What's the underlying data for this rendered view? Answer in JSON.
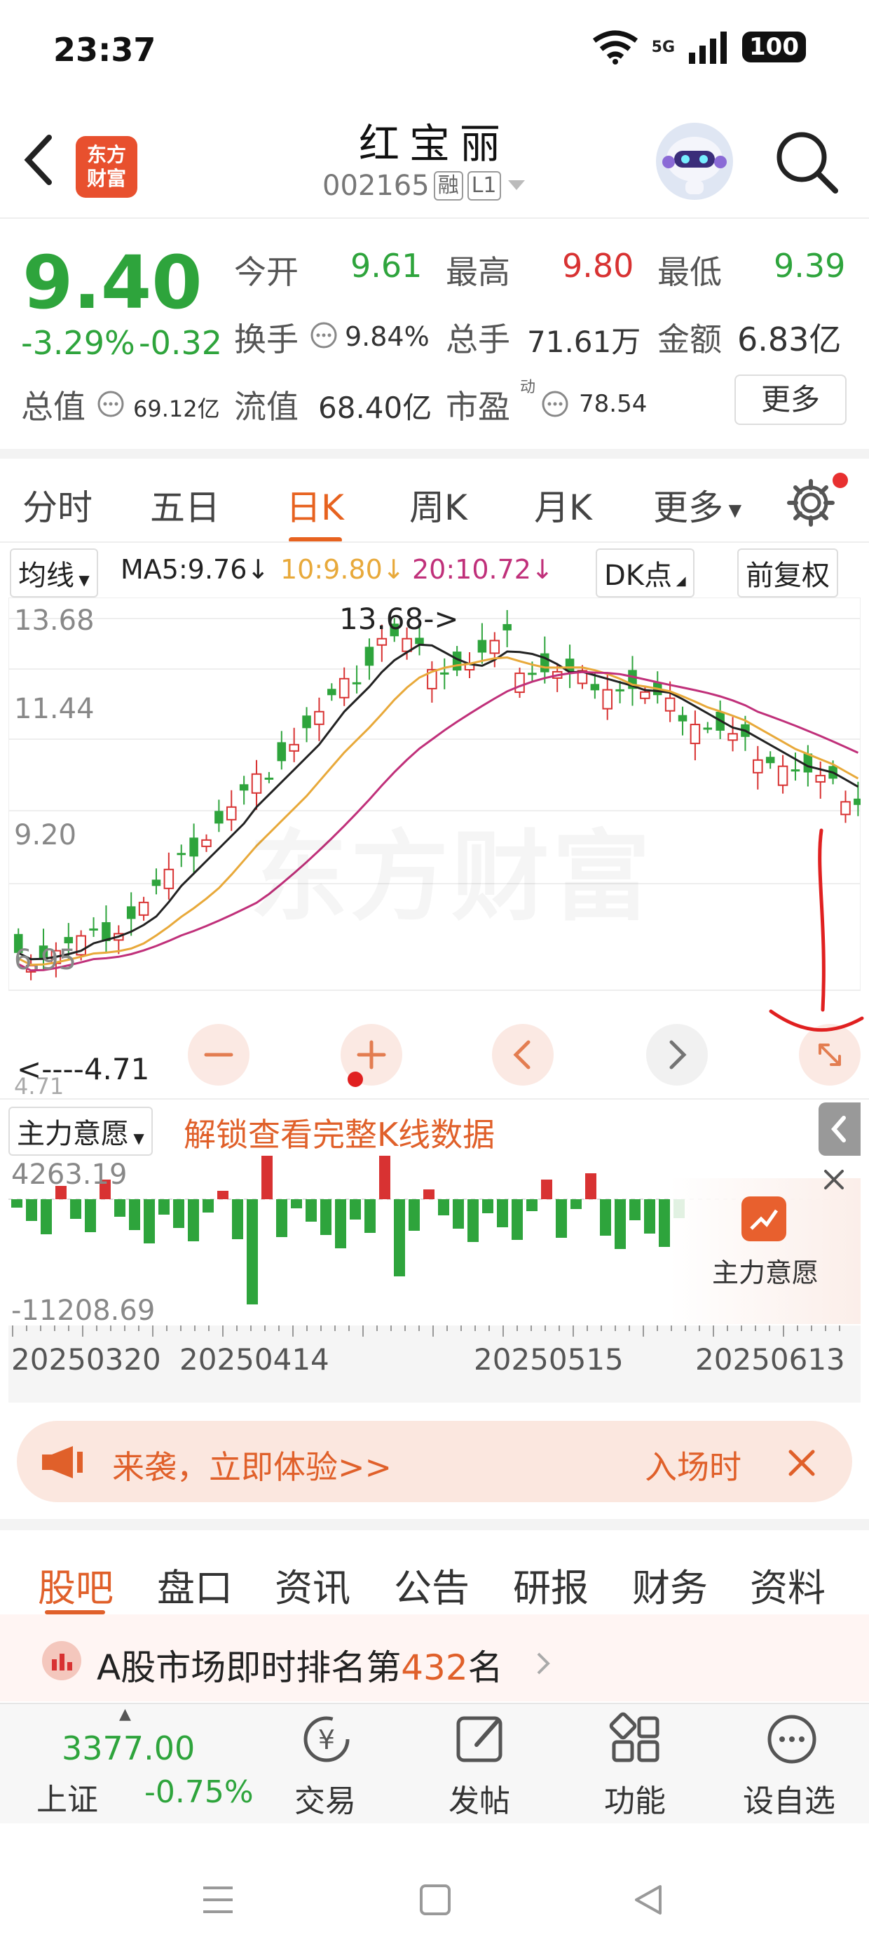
{
  "status": {
    "time": "23:37",
    "network": "5G",
    "battery": "100"
  },
  "header": {
    "title": "红宝丽",
    "code": "002165",
    "tag1": "融",
    "tag2": "L1",
    "logo_line1": "东方",
    "logo_line2": "财富"
  },
  "quote": {
    "price": "9.40",
    "change_pct": "-3.29%",
    "change": "-0.32",
    "open_label": "今开",
    "open": "9.61",
    "high_label": "最高",
    "high": "9.80",
    "low_label": "最低",
    "low": "9.39",
    "turnover_label": "换手",
    "turnover": "9.84%",
    "volume_label": "总手",
    "volume": "71.61万",
    "amount_label": "金额",
    "amount": "6.83亿",
    "mktcap_label": "总值",
    "mktcap": "69.12亿",
    "float_label": "流值",
    "float": "68.40亿",
    "pe_label": "市盈",
    "pe_sup": "动",
    "pe": "78.54",
    "more": "更多"
  },
  "tabs": {
    "items": [
      "分时",
      "五日",
      "日K",
      "周K",
      "月K",
      "更多"
    ],
    "active": "日K"
  },
  "ma": {
    "selector": "均线",
    "ma5": "MA5:9.76↓",
    "ma10": "10:9.80↓",
    "ma20": "20:10.72↓",
    "dk": "DK点",
    "adjust": "前复权"
  },
  "chart_data": {
    "type": "candlestick",
    "y_ticks": [
      "13.68",
      "11.44",
      "9.20",
      "6.95"
    ],
    "y_min_label": "4.71",
    "max_annotation": "13.68->",
    "min_annotation": "<----4.71",
    "ma_colors": {
      "ma5": "#222222",
      "ma10": "#e8a93a",
      "ma20": "#c0307a"
    },
    "watermark": "东方财富"
  },
  "indicator": {
    "selector": "主力意愿",
    "unlock_text": "解锁查看完整K线数据",
    "top_value": "4263.19",
    "bottom_value": "-11208.69",
    "button_label": "主力意愿"
  },
  "dates": [
    "20250320",
    "20250414",
    "20250515",
    "20250613"
  ],
  "banner": {
    "text": "来袭，立即体验>>",
    "right": "入场时"
  },
  "segments": {
    "items": [
      "股吧",
      "盘口",
      "资讯",
      "公告",
      "研报",
      "财务",
      "资料"
    ],
    "active": "股吧"
  },
  "rank": {
    "prefix": "A股市场即时排名第",
    "number": "432",
    "suffix": "名"
  },
  "bottom_bar": {
    "index_value": "3377.00",
    "index_name": "上证",
    "index_change": "-0.75%",
    "trade": "交易",
    "post": "发帖",
    "func": "功能",
    "watch": "设自选"
  }
}
